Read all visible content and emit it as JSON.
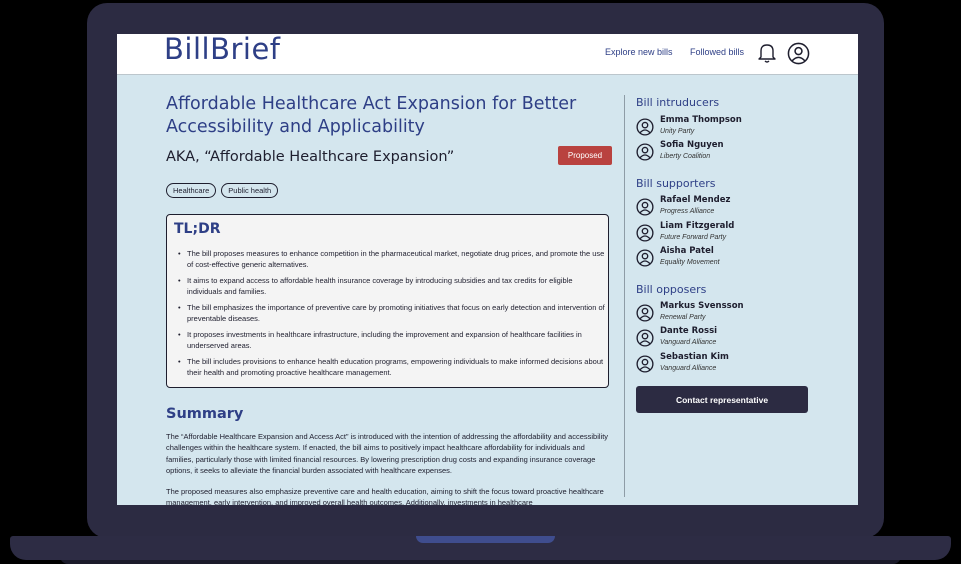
{
  "app": {
    "logo": "BillBrief"
  },
  "nav": {
    "explore": "Explore new bills",
    "followed": "Followed bills",
    "notifications_icon": "bell-icon",
    "profile_icon": "user-circle-icon"
  },
  "bill": {
    "title": "Affordable Healthcare Act Expansion for Better Accessibility and Applicability",
    "aka": "AKA, “Affordable Healthcare Expansion”",
    "status": "Proposed",
    "tags": [
      "Healthcare",
      "Public health"
    ]
  },
  "tldr": {
    "title": "TL;DR",
    "items": [
      "The bill proposes measures to enhance competition in the pharmaceutical market, negotiate drug prices, and promote the use of cost-effective generic alternatives.",
      "It aims to expand access to affordable health insurance coverage by introducing subsidies and tax credits for eligible individuals and families.",
      "The bill emphasizes the importance of preventive care by promoting initiatives that focus on early detection and intervention of preventable diseases.",
      "It proposes investments in healthcare infrastructure, including the improvement and expansion of healthcare facilities in underserved areas.",
      "The bill includes provisions to enhance health education programs, empowering individuals to make informed decisions about their health and promoting proactive healthcare management."
    ]
  },
  "summary": {
    "title": "Summary",
    "paragraphs": [
      "The “Affordable Healthcare Expansion and Access Act” is introduced with the intention of addressing the affordability and accessibility challenges within the healthcare system. If enacted, the bill aims to positively impact healthcare affordability for individuals and families, particularly those with limited financial resources. By lowering prescription drug costs and expanding insurance coverage options, it seeks to alleviate the financial burden associated with healthcare expenses.",
      "The proposed measures also emphasize preventive care and health education, aiming to shift the focus toward proactive healthcare management, early intervention, and improved overall health outcomes. Additionally, investments in healthcare"
    ]
  },
  "sidebar": {
    "introducers": {
      "title": "Bill intruduсers",
      "people": [
        {
          "name": "Emma Thompson",
          "party": "Unity Party"
        },
        {
          "name": "Sofia Nguyen",
          "party": "Liberty Coalition"
        }
      ]
    },
    "supporters": {
      "title": "Bill supporters",
      "people": [
        {
          "name": "Rafael Mendez",
          "party": "Progress Alliance"
        },
        {
          "name": "Liam Fitzgerald",
          "party": "Future Forward Party"
        },
        {
          "name": "Aisha Patel",
          "party": "Equality Movement"
        }
      ]
    },
    "opposers": {
      "title": "Bill opposers",
      "people": [
        {
          "name": "Markus Svensson",
          "party": "Renewal Party"
        },
        {
          "name": "Dante Rossi",
          "party": "Vanguard Alliance"
        },
        {
          "name": "Sebastian Kim",
          "party": "Vanguard Alliance"
        }
      ]
    },
    "contact_button": "Contact representative"
  },
  "colors": {
    "accent": "#2e3f86",
    "background": "#d4e6ee",
    "status_proposed": "#b9423f",
    "dark": "#2c2b42"
  }
}
